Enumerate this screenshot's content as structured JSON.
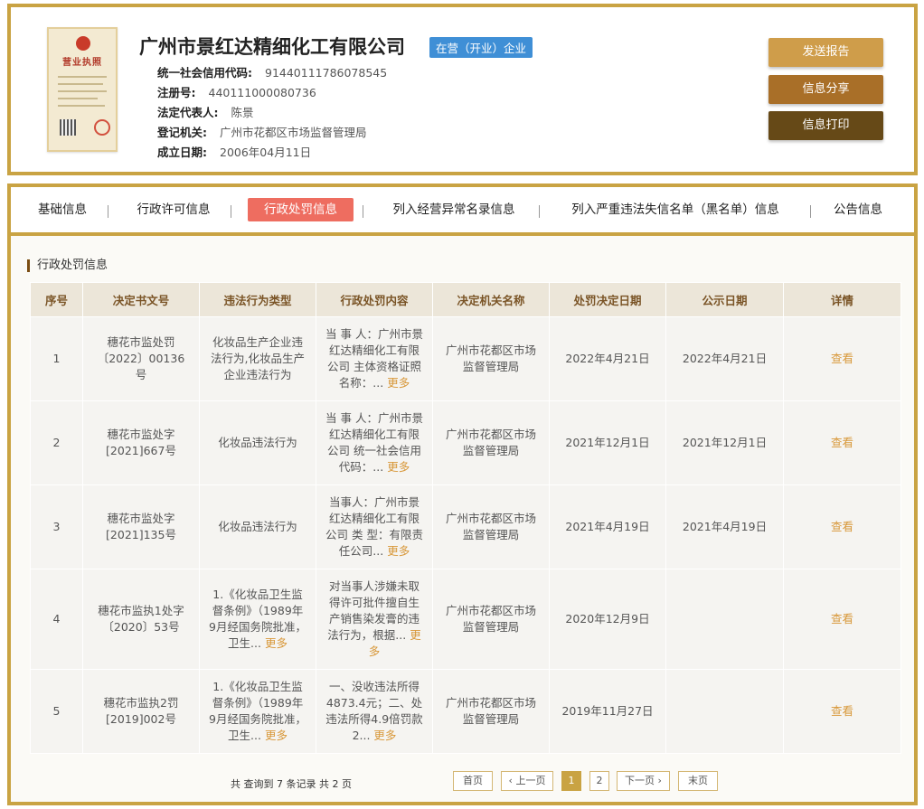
{
  "company": {
    "name": "广州市景红达精细化工有限公司",
    "status": "在营（开业）企业",
    "license_image": {
      "title": "营业执照"
    },
    "fields": [
      {
        "label": "统一社会信用代码:",
        "value": "91440111786078545"
      },
      {
        "label": "注册号:",
        "value": "440111000080736"
      },
      {
        "label": "法定代表人:",
        "value": "陈景"
      },
      {
        "label": "登记机关:",
        "value": "广州市花都区市场监督管理局"
      },
      {
        "label": "成立日期:",
        "value": "2006年04月11日"
      }
    ]
  },
  "actions": {
    "send_report": "发送报告",
    "share": "信息分享",
    "print": "信息打印"
  },
  "tabs": [
    {
      "label": "基础信息"
    },
    {
      "label": "行政许可信息"
    },
    {
      "label": "行政处罚信息",
      "active": true
    },
    {
      "label": "列入经营异常名录信息"
    },
    {
      "label": "列入严重违法失信名单（黑名单）信息"
    },
    {
      "label": "公告信息"
    }
  ],
  "section": {
    "title": "行政处罚信息"
  },
  "table": {
    "headers": [
      "序号",
      "决定书文号",
      "违法行为类型",
      "行政处罚内容",
      "决定机关名称",
      "处罚决定日期",
      "公示日期",
      "详情"
    ],
    "more_label": "更多",
    "view_label": "查看",
    "rows": [
      {
        "no": "1",
        "doc": "穗花市监处罚〔2022〕00136号",
        "type": "化妆品生产企业违法行为,化妆品生产企业违法行为",
        "content": "当 事 人：广州市景红达精细化工有限公司 主体资格证照名称：...",
        "org": "广州市花都区市场监督管理局",
        "decision_date": "2022年4月21日",
        "publish_date": "2022年4月21日"
      },
      {
        "no": "2",
        "doc": "穗花市监处字[2021]667号",
        "type": "化妆品违法行为",
        "content": "当 事 人：广州市景红达精细化工有限公司 统一社会信用代码：...",
        "org": "广州市花都区市场监督管理局",
        "decision_date": "2021年12月1日",
        "publish_date": "2021年12月1日"
      },
      {
        "no": "3",
        "doc": "穗花市监处字[2021]135号",
        "type": "化妆品违法行为",
        "content": "当事人：广州市景红达精细化工有限公司 类 型：有限责任公司...",
        "org": "广州市花都区市场监督管理局",
        "decision_date": "2021年4月19日",
        "publish_date": "2021年4月19日"
      },
      {
        "no": "4",
        "doc": "穗花市监执1处字〔2020〕53号",
        "type": "1.《化妆品卫生监督条例》（1989年9月经国务院批准，卫生...",
        "content": "对当事人涉嫌未取得许可批件擅自生产销售染发膏的违法行为，根据...",
        "org": "广州市花都区市场监督管理局",
        "decision_date": "2020年12月9日",
        "publish_date": ""
      },
      {
        "no": "5",
        "doc": "穗花市监执2罚[2019]002号",
        "type": "1.《化妆品卫生监督条例》（1989年9月经国务院批准，卫生...",
        "content": "一、没收违法所得4873.4元；二、处违法所得4.9倍罚款2...",
        "org": "广州市花都区市场监督管理局",
        "decision_date": "2019年11月27日",
        "publish_date": ""
      }
    ]
  },
  "pagination": {
    "summary": "共 查询到 7 条记录 共 2 页",
    "first": "首页",
    "prev": "‹ 上一页",
    "pages": [
      "1",
      "2"
    ],
    "current": "1",
    "next": "下一页 ›",
    "last": "末页"
  }
}
